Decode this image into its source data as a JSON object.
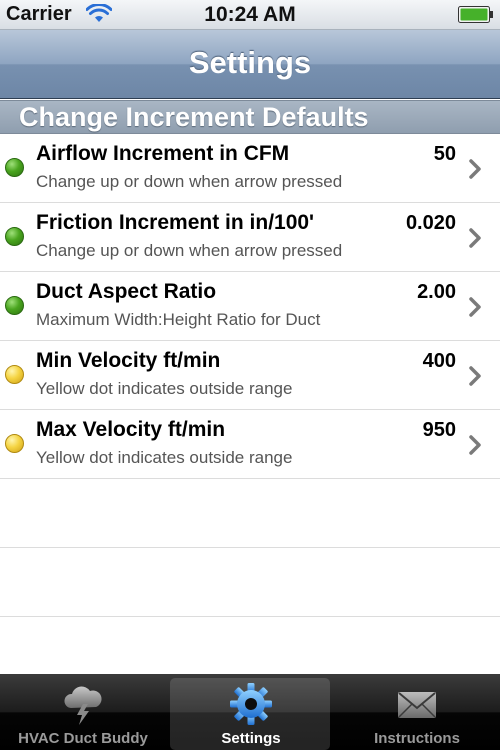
{
  "status_bar": {
    "carrier": "Carrier",
    "time": "10:24 AM"
  },
  "nav": {
    "title": "Settings"
  },
  "section": {
    "title": "Change Increment Defaults"
  },
  "rows": [
    {
      "title": "Airflow Increment in CFM",
      "subtitle": "Change up or down when arrow pressed",
      "value": "50",
      "dot": "green"
    },
    {
      "title": "Friction Increment in in/100'",
      "subtitle": "Change up or down when arrow pressed",
      "value": "0.020",
      "dot": "green"
    },
    {
      "title": "Duct Aspect Ratio",
      "subtitle": "Maximum Width:Height Ratio for Duct",
      "value": "2.00",
      "dot": "green"
    },
    {
      "title": "Min Velocity ft/min",
      "subtitle": "Yellow dot indicates outside range",
      "value": "400",
      "dot": "yellow"
    },
    {
      "title": "Max Velocity ft/min",
      "subtitle": "Yellow dot indicates outside range",
      "value": "950",
      "dot": "yellow"
    }
  ],
  "tabs": [
    {
      "label": "HVAC Duct Buddy",
      "icon": "cloud-lightning-icon",
      "selected": false
    },
    {
      "label": "Settings",
      "icon": "gear-icon",
      "selected": true
    },
    {
      "label": "Instructions",
      "icon": "envelope-icon",
      "selected": false
    }
  ],
  "colors": {
    "dot_green": "#4aa51f",
    "dot_yellow": "#f5d443",
    "nav_bar": "#7891b0",
    "section_header": "#98a6b6",
    "tab_selected_icon": "#3a8ee6"
  }
}
